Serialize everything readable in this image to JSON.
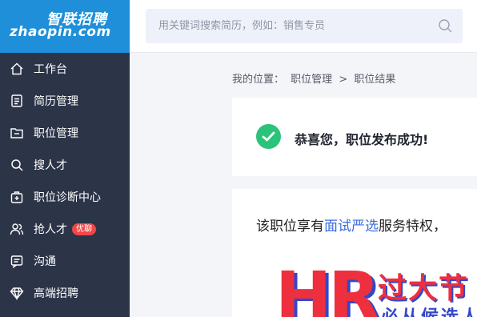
{
  "brand": {
    "name_cn": "智联招聘",
    "name_en": "zhaopin.com",
    "color": "#1e8fd8"
  },
  "sidebar": {
    "items": [
      {
        "label": "工作台",
        "icon": "home-icon"
      },
      {
        "label": "简历管理",
        "icon": "document-icon"
      },
      {
        "label": "职位管理",
        "icon": "folder-icon"
      },
      {
        "label": "搜人才",
        "icon": "search-icon"
      },
      {
        "label": "职位诊断中心",
        "icon": "medical-kit-icon"
      },
      {
        "label": "抢人才",
        "icon": "users-icon",
        "badge": "优聊"
      },
      {
        "label": "沟通",
        "icon": "chat-icon"
      },
      {
        "label": "高端招聘",
        "icon": "diamond-icon"
      }
    ]
  },
  "search": {
    "placeholder": "用关键词搜索简历，例如：销售专员"
  },
  "breadcrumb": {
    "prefix": "我的位置：",
    "items": [
      "职位管理",
      "职位结果"
    ],
    "separator": ">"
  },
  "success": {
    "message": "恭喜您，职位发布成功!",
    "color": "#2ac37a"
  },
  "promo": {
    "text_before": "该职位享有",
    "highlight": "面试严选",
    "text_after": "服务特权，",
    "art_letters": "HR",
    "slogan_line1": "过大节",
    "slogan_line2": "必从候选人"
  }
}
